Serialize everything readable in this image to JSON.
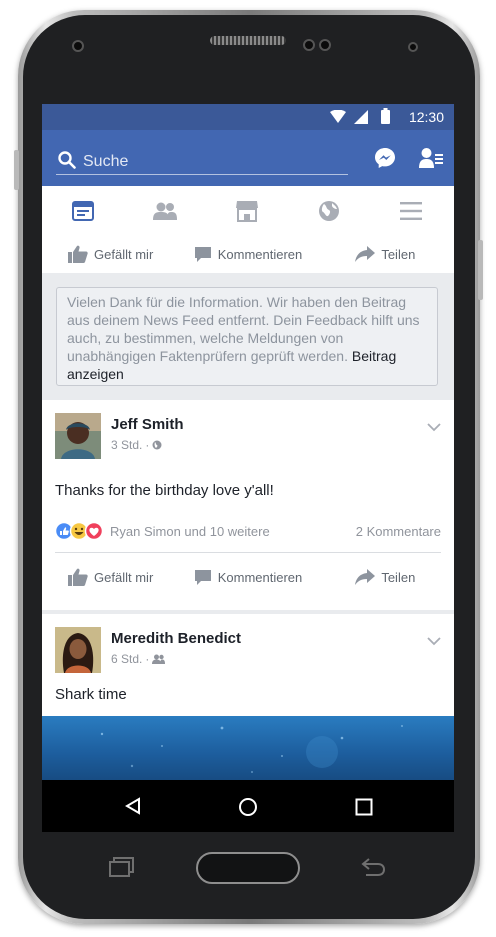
{
  "status_bar": {
    "time": "12:30"
  },
  "app_bar": {
    "search_placeholder": "Suche"
  },
  "actions": {
    "like": "Gefällt mir",
    "comment": "Kommentieren",
    "share": "Teilen"
  },
  "notice": {
    "text": "Vielen Dank für die Information. Wir haben den Beitrag aus deinem News Feed entfernt. Dein Feedback hilft uns auch, zu bestimmen, welche Meldungen von unabhängigen Faktenprüfern geprüft werden.",
    "link": "Beitrag anzeigen"
  },
  "posts": [
    {
      "author": "Jeff Smith",
      "time": "3 Std.",
      "privacy_icon": "globe-icon",
      "text": "Thanks for the birthday love y'all!",
      "reactions": "Ryan Simon und 10 weitere",
      "comments": "2 Kommentare"
    },
    {
      "author": "Meredith Benedict",
      "time": "6 Std.",
      "privacy_icon": "friends-icon",
      "text": "Shark time"
    }
  ],
  "colors": {
    "status_bar": "#3b5998",
    "app_bar": "#4267b2",
    "active_tab": "#4267b2"
  }
}
